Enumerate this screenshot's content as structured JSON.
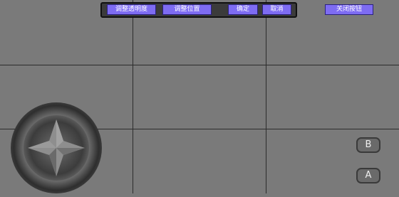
{
  "toolbar": {
    "adjust_opacity": "调整透明度",
    "adjust_position": "调整位置",
    "confirm": "确定",
    "cancel": "取消"
  },
  "close_button": "关闭按钮",
  "buttons": {
    "b": "B",
    "a": "A"
  },
  "colors": {
    "background": "#7a7a7a",
    "grid": "#2c2c2c",
    "button_fill": "#7e6cf2",
    "toolbar_bg": "#3b3b3b"
  },
  "icons": {
    "joystick": "dpad-joystick-icon"
  }
}
